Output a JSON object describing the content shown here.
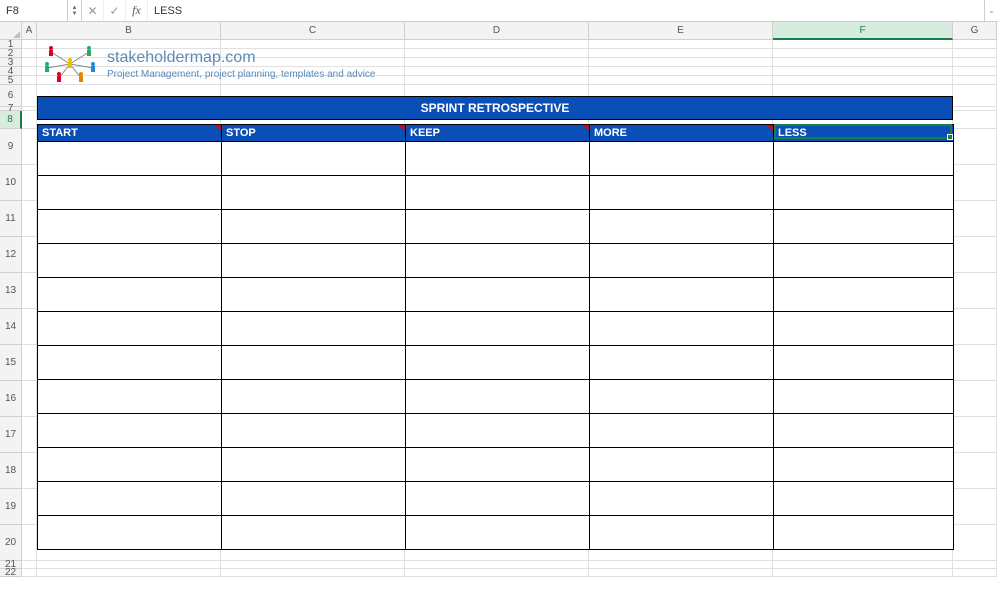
{
  "formula_bar": {
    "cell_ref": "F8",
    "formula_value": "LESS",
    "fx_label": "fx"
  },
  "columns": [
    "A",
    "B",
    "C",
    "D",
    "E",
    "F",
    "G"
  ],
  "row_numbers": [
    "1",
    "2",
    "3",
    "4",
    "5",
    "6",
    "7",
    "8",
    "9",
    "10",
    "11",
    "12",
    "13",
    "14",
    "15",
    "16",
    "17",
    "18",
    "19",
    "20",
    "21",
    "22"
  ],
  "brand": {
    "title": "stakeholdermap.com",
    "subtitle": "Project Management, project planning, templates and advice"
  },
  "sheet": {
    "title": "SPRINT RETROSPECTIVE",
    "headers": [
      "START",
      "STOP",
      "KEEP",
      "MORE",
      "LESS"
    ],
    "data_rows": 12
  },
  "selected_cell": "F8"
}
